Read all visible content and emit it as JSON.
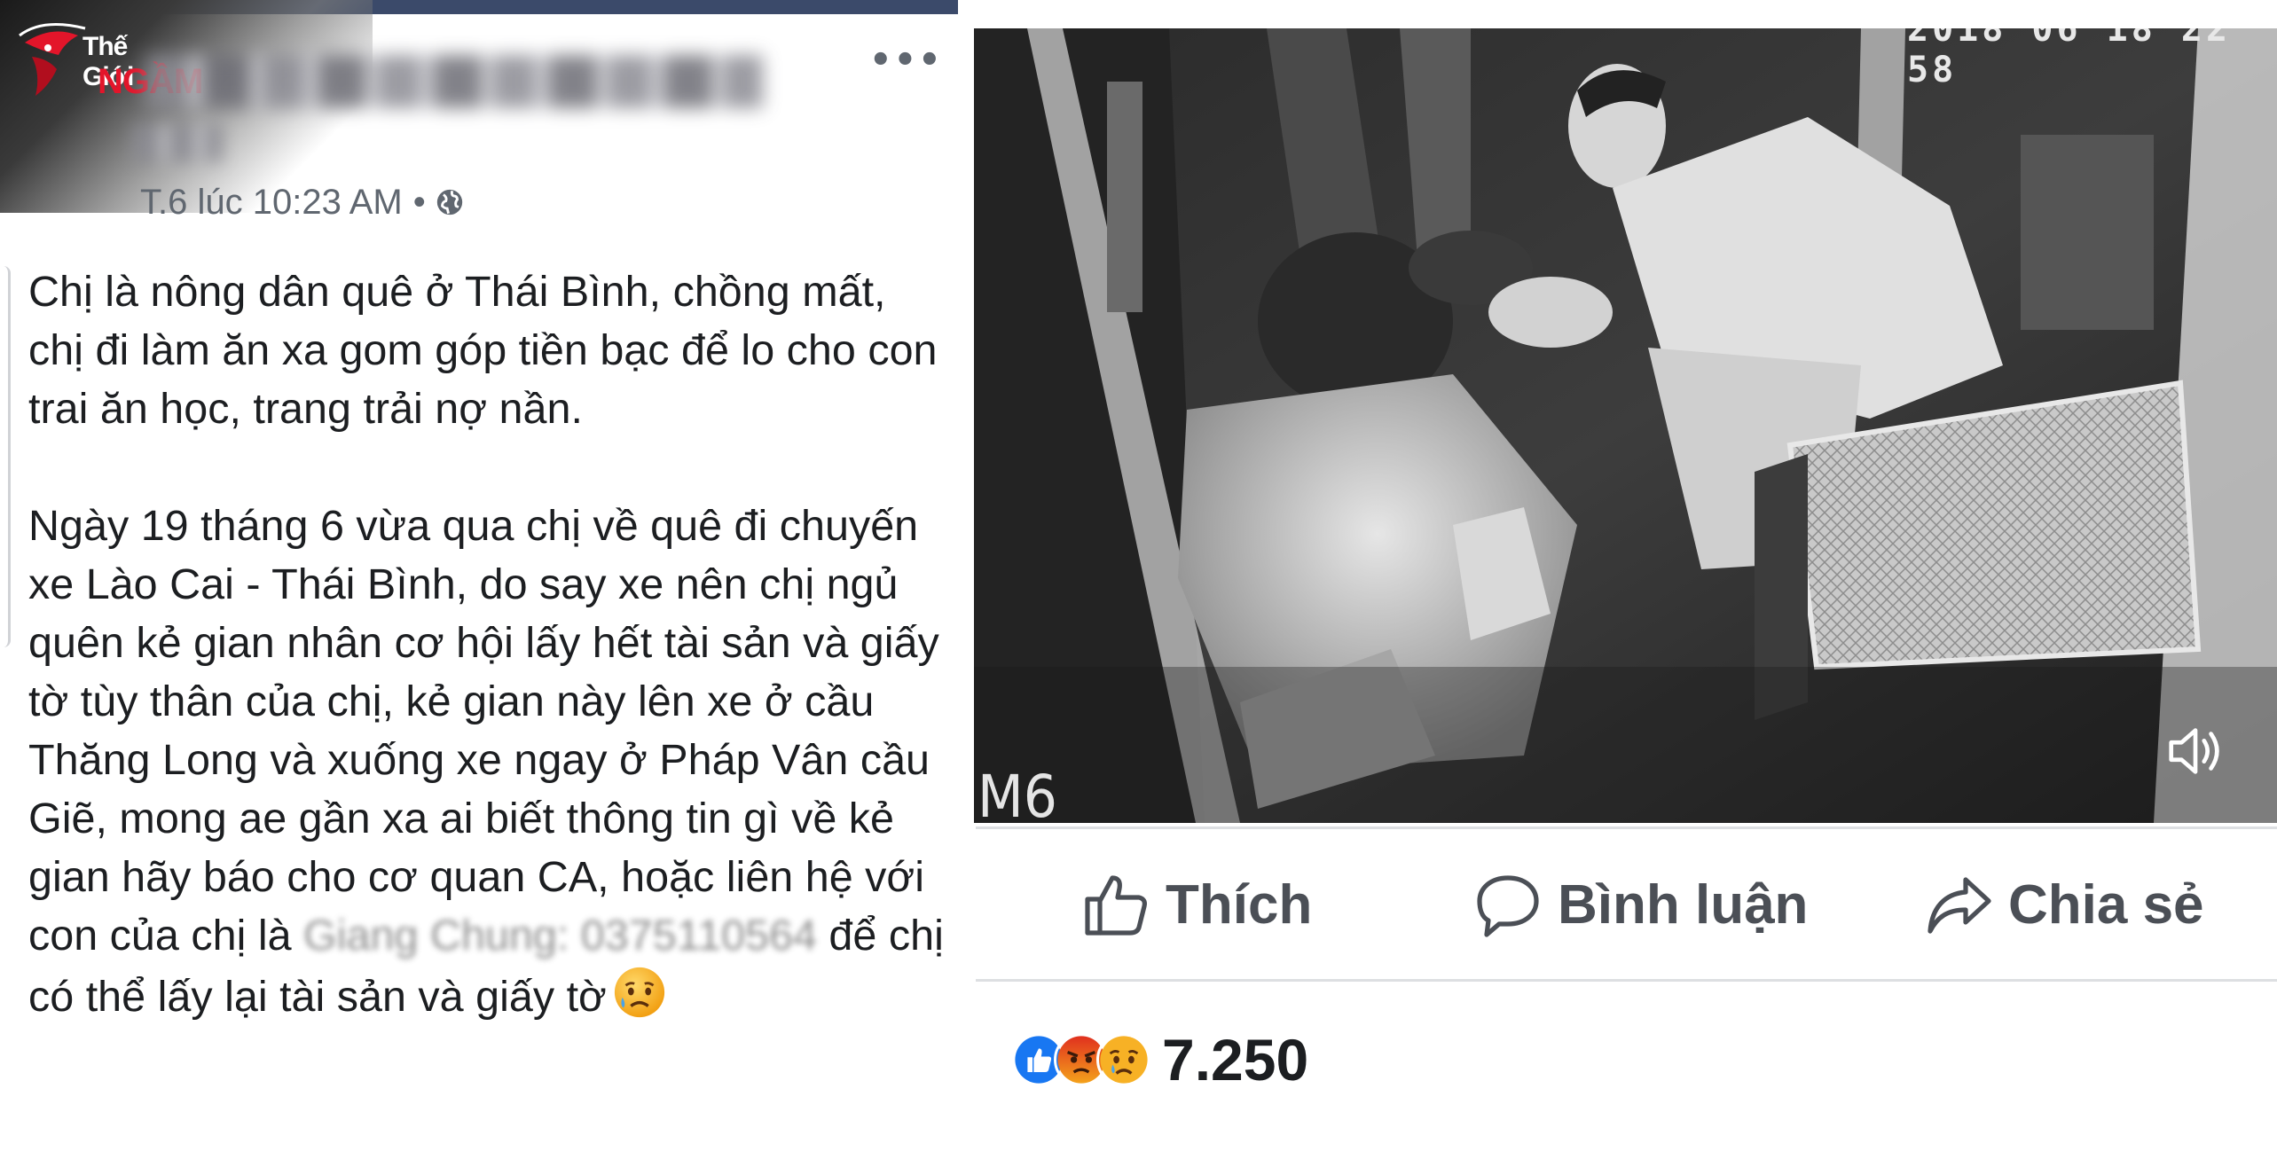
{
  "watermark": {
    "line1": "Thế Giới",
    "line2": "NGẦM",
    "colors": {
      "line1": "#ffffff",
      "line2": "#e3152a"
    }
  },
  "post": {
    "timestamp": "T.6 lúc 10:23 AM",
    "separator": "•",
    "audience_icon": "globe-icon",
    "more_icon": "more-options-icon",
    "more_label": "•••",
    "paragraph_1": "Chị là nông dân quê ở Thái Bình, chồng mất, chị đi làm ăn xa gom góp tiền bạc để lo cho con trai ăn học, trang trải nợ nần.",
    "paragraph_2_before": "Ngày 19 tháng 6 vừa qua chị về quê đi chuyến xe Lào Cai - Thái Bình, do say xe nên chị ngủ quên kẻ gian nhân cơ hội lấy hết tài sản và giấy tờ tùy thân của chị, kẻ gian này lên xe ở cầu Thăng Long và xuống xe ngay ở Pháp Vân cầu Giẽ, mong ae gần xa ai biết thông tin gì về kẻ gian hãy báo cho cơ quan CA, hoặc liên hệ với con của chị là ",
    "paragraph_2_contact": "Giang Chung: 0375110564",
    "paragraph_2_after": " để chị có thể lấy lại tài sản và giấy tờ",
    "end_emoji": "sad-face-emoji"
  },
  "video": {
    "timestamp_partial": "2018 06 18 22 58",
    "camera_label": "M6",
    "volume_icon": "volume-icon"
  },
  "actions": {
    "like_label": "Thích",
    "comment_label": "Bình luận",
    "share_label": "Chia sẻ",
    "text_color": "#4b4f56"
  },
  "reactions": {
    "types": [
      "like",
      "angry",
      "sad"
    ],
    "colors": {
      "like": "#1877f2",
      "angry": "#e9710f",
      "sad": "#f7b125"
    },
    "count": "7.250"
  }
}
